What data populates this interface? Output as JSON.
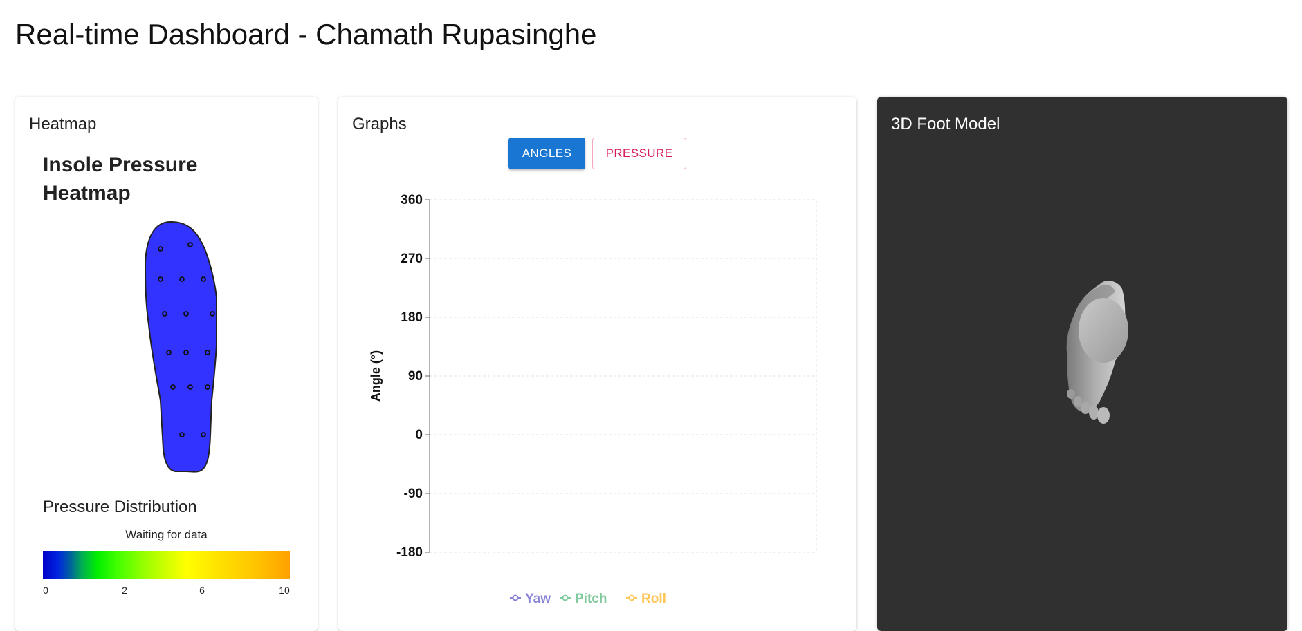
{
  "page": {
    "title": "Real-time Dashboard - Chamath Rupasinghe"
  },
  "heatmap": {
    "card_title": "Heatmap",
    "insole_title": "Insole Pressure Heatmap",
    "insole_fill": "#3333ff",
    "distribution_title": "Pressure Distribution",
    "status": "Waiting for data",
    "scale_ticks": [
      "0",
      "2",
      "6",
      "10"
    ]
  },
  "graphs": {
    "card_title": "Graphs",
    "buttons": {
      "angles": "ANGLES",
      "pressure": "PRESSURE"
    },
    "active_tab": "ANGLES"
  },
  "foot_model": {
    "card_title": "3D Foot Model",
    "background": "#303030"
  },
  "chart_data": {
    "type": "line",
    "title": "",
    "xlabel": "",
    "ylabel": "Angle (°)",
    "ylim": [
      -180,
      360
    ],
    "yticks": [
      "360",
      "270",
      "180",
      "90",
      "0",
      "-90",
      "-180"
    ],
    "grid": true,
    "legend_position": "bottom",
    "series": [
      {
        "name": "Yaw",
        "color": "#8884d8",
        "values": []
      },
      {
        "name": "Pitch",
        "color": "#82ca9d",
        "values": []
      },
      {
        "name": "Roll",
        "color": "#ffc658",
        "values": []
      }
    ]
  }
}
